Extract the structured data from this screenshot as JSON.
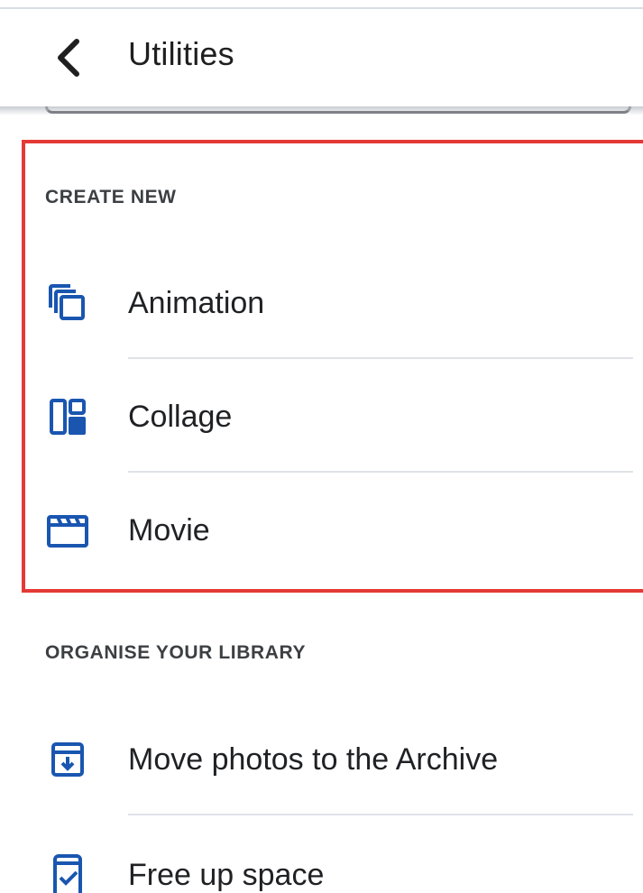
{
  "header": {
    "title": "Utilities",
    "back_icon": "chevron-left-icon"
  },
  "highlight_color": "#e53935",
  "accent_color": "#1a56b0",
  "sections": [
    {
      "heading": "CREATE NEW",
      "items": [
        {
          "label": "Animation",
          "icon": "animation-stack-icon"
        },
        {
          "label": "Collage",
          "icon": "collage-icon"
        },
        {
          "label": "Movie",
          "icon": "movie-clapper-icon"
        }
      ]
    },
    {
      "heading": "ORGANISE YOUR LIBRARY",
      "items": [
        {
          "label": "Move photos to the Archive",
          "icon": "archive-download-icon"
        },
        {
          "label": "Free up space",
          "icon": "phone-check-icon"
        }
      ]
    }
  ]
}
